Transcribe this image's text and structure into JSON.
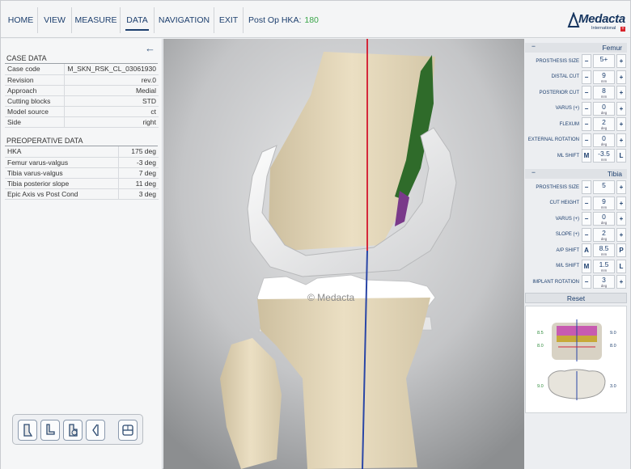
{
  "menu": {
    "items": [
      "HOME",
      "VIEW",
      "MEASURE",
      "DATA",
      "NAVIGATION",
      "EXIT"
    ],
    "active": "DATA",
    "hka_label": "Post Op HKA:",
    "hka_value": "180"
  },
  "logo": {
    "name": "Medacta",
    "sub": "International",
    "cross": "+"
  },
  "left": {
    "back_icon": "←",
    "case_title": "CASE DATA",
    "case_rows": [
      {
        "label": "Case code",
        "value": "M_SKN_RSK_CL_03061930"
      },
      {
        "label": "Revision",
        "value": "rev.0"
      },
      {
        "label": "Approach",
        "value": "Medial"
      },
      {
        "label": "Cutting blocks",
        "value": "STD"
      },
      {
        "label": "Model source",
        "value": "ct"
      },
      {
        "label": "Side",
        "value": "right"
      }
    ],
    "pre_title": "PREOPERATIVE DATA",
    "pre_rows": [
      {
        "label": "HKA",
        "value": "175 deg"
      },
      {
        "label": "Femur varus-valgus",
        "value": "-3 deg"
      },
      {
        "label": "Tibia varus-valgus",
        "value": "7 deg"
      },
      {
        "label": "Tibia posterior slope",
        "value": "11 deg"
      },
      {
        "label": "Epic Axis vs Post Cond",
        "value": "3 deg"
      }
    ],
    "tools": [
      "femur-view-icon",
      "tibia-view-icon",
      "combined-view-icon",
      "lateral-view-icon",
      "layout-icon"
    ]
  },
  "viewport": {
    "watermark": "© Medacta"
  },
  "femur": {
    "title": "Femur",
    "collapse": "−",
    "rows": [
      {
        "label": "PROSTHESIS SIZE",
        "left": "−",
        "value": "5+",
        "unit": "",
        "right": "+"
      },
      {
        "label": "DISTAL CUT",
        "left": "−",
        "value": "9",
        "unit": "mm",
        "right": "+"
      },
      {
        "label": "POSTERIOR CUT",
        "left": "−",
        "value": "8",
        "unit": "mm",
        "right": "+"
      },
      {
        "label": "VARUS (+)",
        "left": "−",
        "value": "0",
        "unit": "deg",
        "right": "+"
      },
      {
        "label": "FLEXUM",
        "left": "−",
        "value": "2",
        "unit": "deg",
        "right": "+"
      },
      {
        "label": "EXTERNAL ROTATION",
        "left": "−",
        "value": "0",
        "unit": "deg",
        "right": "+"
      },
      {
        "label": "ML SHIFT",
        "left": "M",
        "value": "-3.5",
        "unit": "mm",
        "right": "L"
      }
    ]
  },
  "tibia": {
    "title": "Tibia",
    "collapse": "−",
    "rows": [
      {
        "label": "PROSTHESIS SIZE",
        "left": "−",
        "value": "5",
        "unit": "",
        "right": "+"
      },
      {
        "label": "CUT HEIGHT",
        "left": "−",
        "value": "9",
        "unit": "mm",
        "right": "+"
      },
      {
        "label": "VARUS (+)",
        "left": "−",
        "value": "0",
        "unit": "deg",
        "right": "+"
      },
      {
        "label": "SLOPE (+)",
        "left": "−",
        "value": "2",
        "unit": "deg",
        "right": "+"
      },
      {
        "label": "A/P SHIFT",
        "left": "A",
        "value": "8.5",
        "unit": "mm",
        "right": "P"
      },
      {
        "label": "M/L SHIFT",
        "left": "M",
        "value": "1.5",
        "unit": "mm",
        "right": "L"
      },
      {
        "label": "IMPLANT ROTATION",
        "left": "−",
        "value": "3",
        "unit": "deg",
        "right": "+"
      }
    ]
  },
  "reset_label": "Reset",
  "thumb": {
    "n1": "8.5",
    "n2": "9.0",
    "n3": "8.0",
    "n4": "8.0",
    "n5": "9.0",
    "n6": "3.0"
  }
}
